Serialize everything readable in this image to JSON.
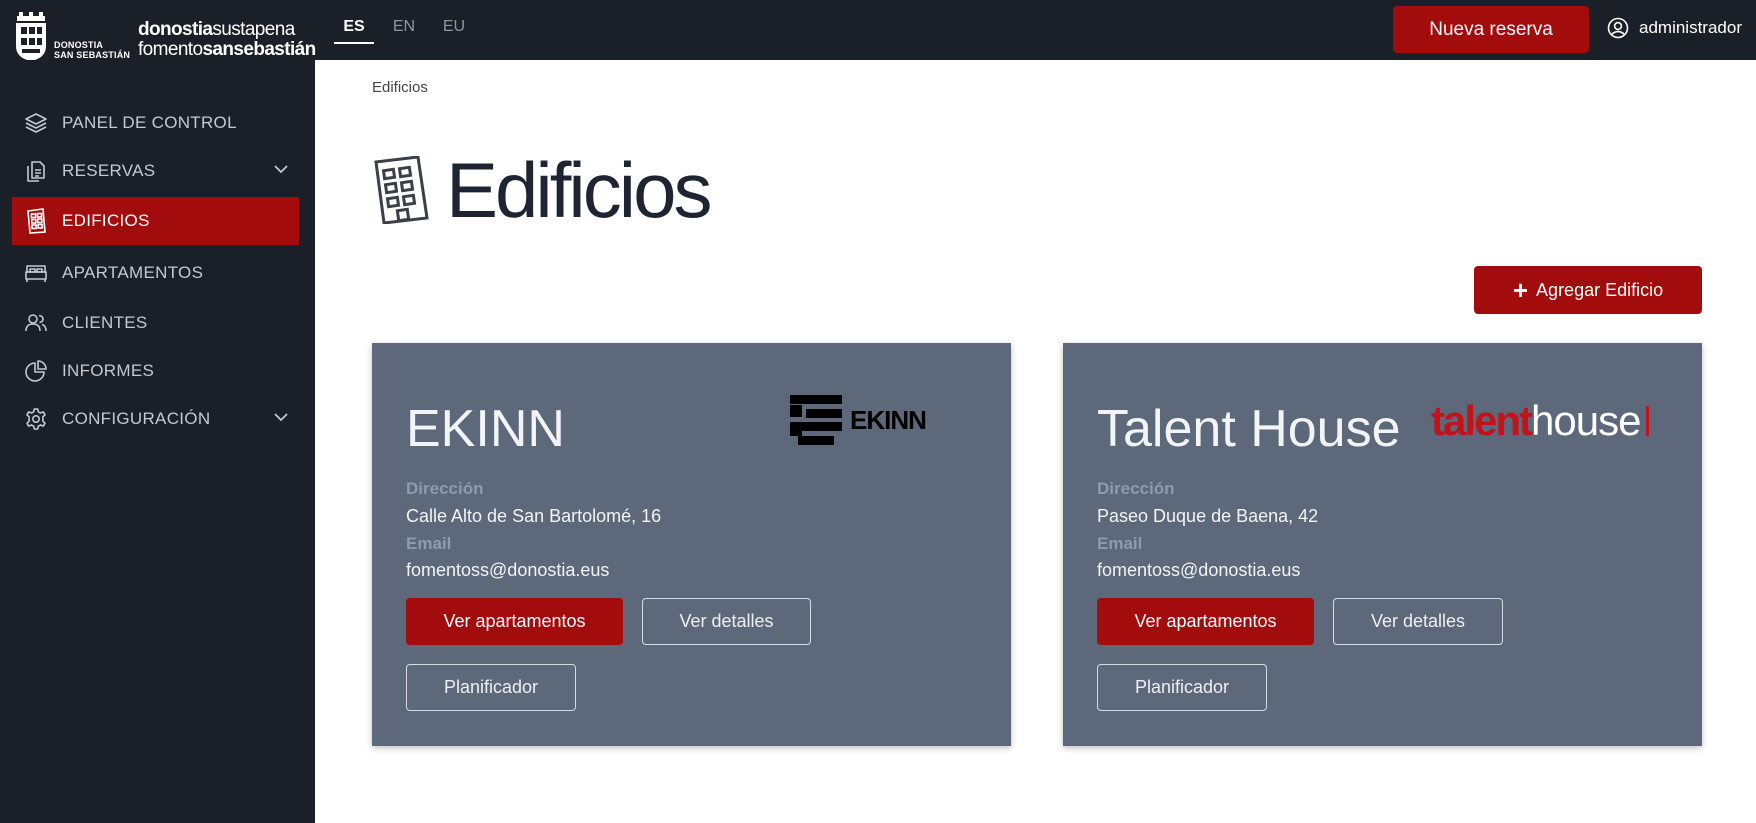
{
  "header": {
    "city_line1": "DONOSTIA",
    "city_line2": "SAN SEBASTIÁN",
    "wordmark_line1_bold": "donostia",
    "wordmark_line1_thin": "sustapena",
    "wordmark_line2_thin": "fomento",
    "wordmark_line2_bold": "sansebastián",
    "languages": [
      "ES",
      "EN",
      "EU"
    ],
    "active_language": "ES",
    "new_booking_label": "Nueva reserva",
    "user_name": "administrador"
  },
  "sidebar": {
    "items": [
      {
        "label": "PANEL DE CONTROL",
        "icon": "layers-icon"
      },
      {
        "label": "RESERVAS",
        "icon": "documents-icon",
        "expandable": true
      },
      {
        "label": "EDIFICIOS",
        "icon": "building-icon",
        "active": true
      },
      {
        "label": "APARTAMENTOS",
        "icon": "bed-icon"
      },
      {
        "label": "CLIENTES",
        "icon": "users-icon"
      },
      {
        "label": "INFORMES",
        "icon": "pie-chart-icon"
      },
      {
        "label": "CONFIGURACIÓN",
        "icon": "gear-icon",
        "expandable": true
      }
    ]
  },
  "main": {
    "breadcrumb": "Edificios",
    "title": "Edificios",
    "add_button_label": "Agregar Edificio",
    "cards": [
      {
        "name": "EKINN",
        "logo_text": "EKINN",
        "address_label": "Dirección",
        "address": "Calle Alto de San Bartolomé, 16",
        "email_label": "Email",
        "email": "fomentoss@donostia.eus",
        "view_apartments_label": "Ver apartamentos",
        "view_details_label": "Ver detalles",
        "planner_label": "Planificador"
      },
      {
        "name": "Talent House",
        "logo_text_red": "talent",
        "logo_text_white": "house",
        "address_label": "Dirección",
        "address": "Paseo Duque de Baena, 42",
        "email_label": "Email",
        "email": "fomentoss@donostia.eus",
        "view_apartments_label": "Ver apartamentos",
        "view_details_label": "Ver detalles",
        "planner_label": "Planificador"
      }
    ]
  },
  "colors": {
    "accent": "#a30c0c",
    "sidebar_bg": "#1b1f27",
    "card_bg": "#5d687a"
  }
}
